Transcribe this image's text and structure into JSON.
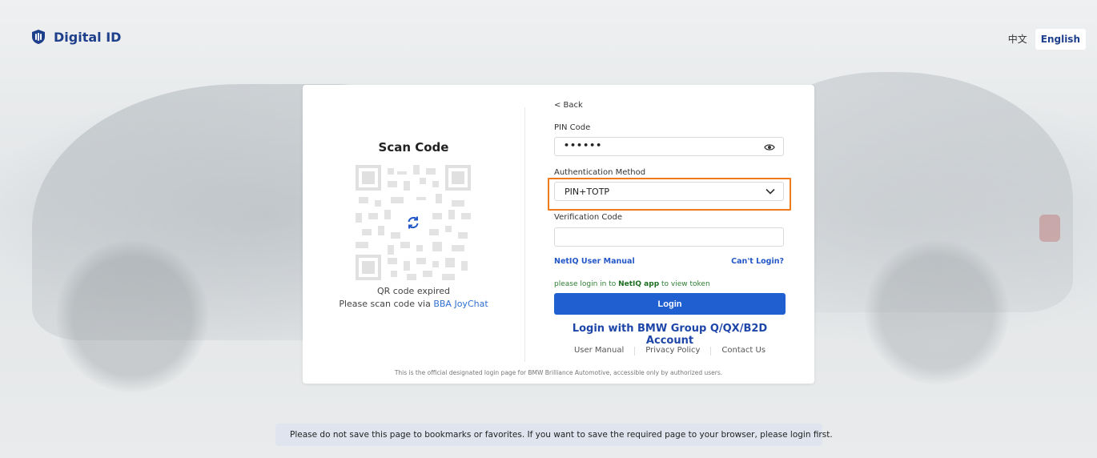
{
  "header": {
    "brand": "Digital ID",
    "brand_icon": "shield-logo-icon",
    "lang_zh": "中文",
    "lang_en": "English"
  },
  "left_panel": {
    "title": "Scan Code",
    "qr_status": "QR code expired",
    "scan_prefix": "Please scan code via ",
    "scan_app": "BBA JoyChat",
    "refresh_icon": "refresh-icon"
  },
  "form": {
    "back_label": "< Back",
    "pin_label": "PIN Code",
    "pin_value": "••••••",
    "auth_label": "Authentication Method",
    "auth_value": "PIN+TOTP",
    "verification_label": "Verification Code",
    "verification_value": "",
    "manual_link": "NetIQ User Manual",
    "cant_login_link": "Can't Login?",
    "hint_prefix": "please login in to ",
    "hint_app": "NetIQ app",
    "hint_suffix": " to view token",
    "login_button": "Login",
    "bmw_login_link": "Login with BMW Group Q/QX/B2D Account",
    "footer_links": [
      "User Manual",
      "Privacy Policy",
      "Contact Us"
    ]
  },
  "official_notice": "This is the official designated login page for BMW Brilliance Automotive, accessible only by authorized users.",
  "bottom_notice": "Please do not save this page to bookmarks or favorites. If you want to save the required page to your browser, please login first.",
  "colors": {
    "primary": "#1f5fd0",
    "brand": "#1e3f8c",
    "highlight": "#f07a1a",
    "hint_green": "#2e7d32"
  }
}
